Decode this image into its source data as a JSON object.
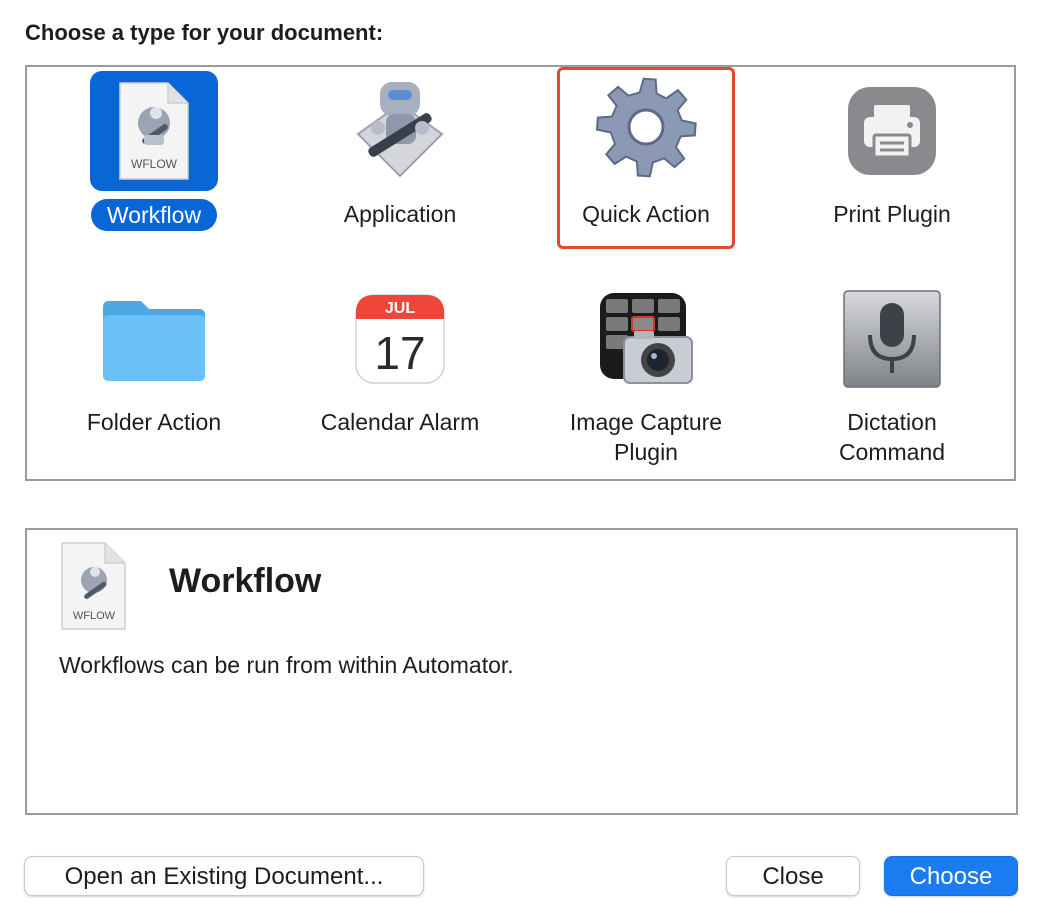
{
  "dialog": {
    "prompt": "Choose a type for your document:"
  },
  "types": [
    {
      "label": "Workflow",
      "icon": "workflow-file-icon",
      "icon_text": "WFLOW",
      "selected": true
    },
    {
      "label": "Application",
      "icon": "automator-robot-icon"
    },
    {
      "label": "Quick Action",
      "icon": "gear-icon",
      "highlighted": true
    },
    {
      "label": "Print Plugin",
      "icon": "printer-icon"
    },
    {
      "label": "Folder Action",
      "icon": "folder-icon"
    },
    {
      "label": "Calendar Alarm",
      "icon": "calendar-icon",
      "month": "JUL",
      "day": "17"
    },
    {
      "label": "Image Capture\nPlugin",
      "icon": "image-capture-camera-icon"
    },
    {
      "label": "Dictation\nCommand",
      "icon": "microphone-icon"
    }
  ],
  "description": {
    "title": "Workflow",
    "icon": "workflow-file-icon",
    "icon_text": "WFLOW",
    "text": "Workflows can be run from within Automator."
  },
  "buttons": {
    "open_existing": "Open an Existing Document...",
    "close": "Close",
    "choose": "Choose"
  },
  "colors": {
    "selection": "#0866d6",
    "highlight_border": "#e04a2f",
    "primary_button": "#1b7cf1"
  }
}
